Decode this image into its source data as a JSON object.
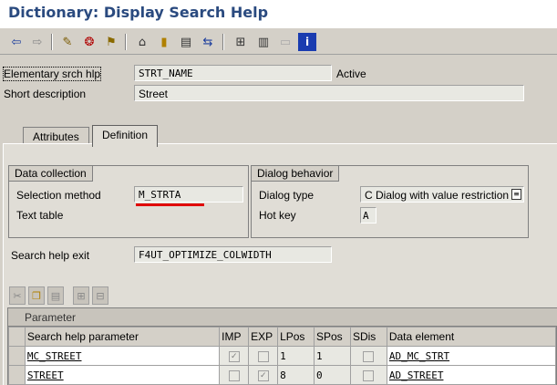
{
  "window": {
    "title": "Dictionary: Display Search Help"
  },
  "toolbar": {
    "icons": [
      "back-arrow-icon",
      "forward-arrow-icon",
      "display-change-icon",
      "other-object-icon",
      "activate-icon",
      "where-used-icon",
      "object-list-icon",
      "navigation-icon",
      "test-icon",
      "hierarchy-icon",
      "print-icon",
      "blank-icon",
      "info-icon"
    ]
  },
  "header": {
    "elementary_label": "Elementary srch hlp",
    "elementary_value": "STRT_NAME",
    "status": "Active",
    "short_desc_label": "Short description",
    "short_desc_value": "Street"
  },
  "tabs": [
    {
      "label": "Attributes"
    },
    {
      "label": "Definition"
    }
  ],
  "data_collection": {
    "title": "Data collection",
    "selection_method_label": "Selection method",
    "selection_method_value": "M_STRTA",
    "text_table_label": "Text table",
    "text_table_value": ""
  },
  "dialog_behavior": {
    "title": "Dialog behavior",
    "dialog_type_label": "Dialog type",
    "dialog_type_value": "C Dialog with value restriction",
    "hot_key_label": "Hot key",
    "hot_key_value": "A"
  },
  "exit": {
    "label": "Search help exit",
    "value": "F4UT_OPTIMIZE_COLWIDTH"
  },
  "grid": {
    "caption": "Parameter",
    "columns": [
      "Search help parameter",
      "IMP",
      "EXP",
      "LPos",
      "SPos",
      "SDis",
      "Data element"
    ],
    "rows": [
      {
        "param": "MC_STREET",
        "imp": true,
        "exp": false,
        "lpos": "1",
        "spos": "1",
        "sdis": false,
        "data_element": "AD_MC_STRT"
      },
      {
        "param": "STREET",
        "imp": false,
        "exp": true,
        "lpos": "8",
        "spos": "0",
        "sdis": false,
        "data_element": "AD_STREET"
      }
    ]
  },
  "colors": {
    "title": "#2a4a7f",
    "highlight_underline": "#e00000"
  }
}
